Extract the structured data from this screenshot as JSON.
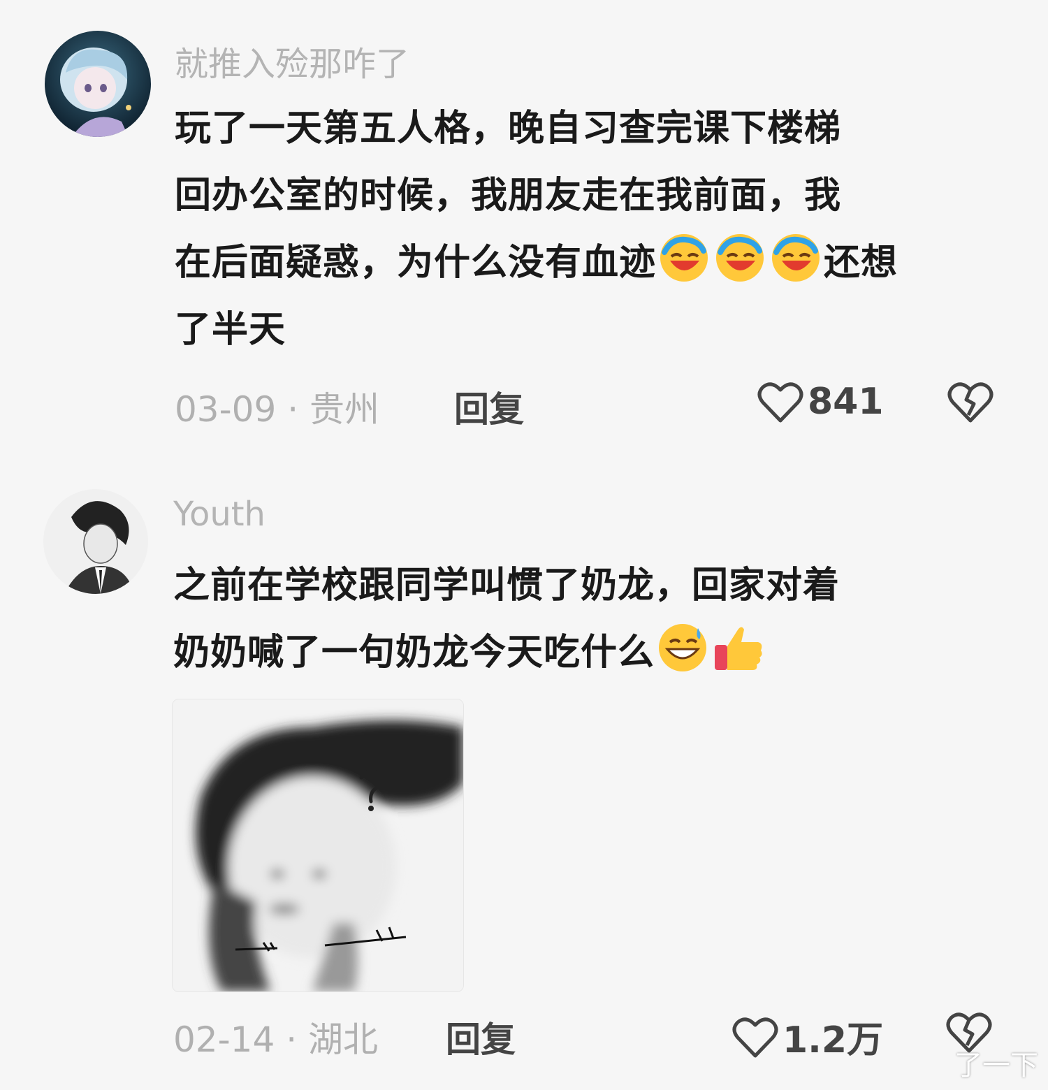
{
  "comments": [
    {
      "username": "就推入殓那咋了",
      "lines": [
        "玩了一天第五人格，晚自习查完课下楼梯",
        "回办公室的时候，我朋友走在我前面，我",
        "在后面疑惑，为什么没有血迹",
        "还想",
        "了半天"
      ],
      "emojis": [
        "rolling-laughing-emoji",
        "rolling-laughing-emoji",
        "rolling-laughing-emoji"
      ],
      "date": "03-09",
      "location": "贵州",
      "reply_label": "回复",
      "likes": "841"
    },
    {
      "username": "Youth",
      "lines": [
        "之前在学校跟同学叫惯了奶龙，回家对着",
        "奶奶喊了一句奶龙今天吃什么"
      ],
      "emojis": [
        "grinning-sweat-emoji",
        "thumbs-up-emoji"
      ],
      "date": "02-14",
      "location": "湖北",
      "reply_label": "回复",
      "likes": "1.2万"
    }
  ],
  "separator": " · ",
  "watermark": "了一下"
}
